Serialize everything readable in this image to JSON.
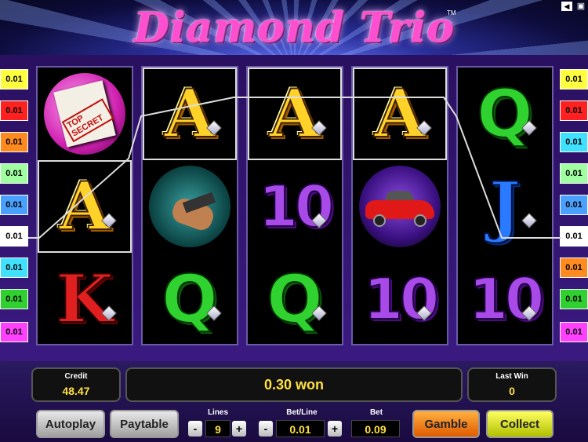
{
  "game": {
    "title": "Diamond Trio",
    "tm": "TM"
  },
  "lines_left": [
    {
      "label": "0.01",
      "color": "#ffff40"
    },
    {
      "label": "0.01",
      "color": "#ff2020"
    },
    {
      "label": "0.01",
      "color": "#ff8a20"
    },
    {
      "label": "0.01",
      "color": "#a0ffa0"
    },
    {
      "label": "0.01",
      "color": "#4aa0ff"
    },
    {
      "label": "0.01",
      "color": "#ffffff"
    },
    {
      "label": "0.01",
      "color": "#40e0ff"
    },
    {
      "label": "0.01",
      "color": "#30d030"
    },
    {
      "label": "0.01",
      "color": "#ff40ff"
    }
  ],
  "lines_right": [
    {
      "label": "0.01",
      "color": "#ffff40"
    },
    {
      "label": "0.01",
      "color": "#ff2020"
    },
    {
      "label": "0.01",
      "color": "#40e0ff"
    },
    {
      "label": "0.01",
      "color": "#a0ffa0"
    },
    {
      "label": "0.01",
      "color": "#4aa0ff"
    },
    {
      "label": "0.01",
      "color": "#ffffff"
    },
    {
      "label": "0.01",
      "color": "#ff8a20"
    },
    {
      "label": "0.01",
      "color": "#30d030"
    },
    {
      "label": "0.01",
      "color": "#ff40ff"
    }
  ],
  "reels": [
    [
      "Top Secret",
      "A",
      "K"
    ],
    [
      "A",
      "Spy",
      "Q"
    ],
    [
      "A",
      "10",
      "Q"
    ],
    [
      "A",
      "Car",
      "10"
    ],
    [
      "Q",
      "J",
      "10"
    ]
  ],
  "secret_stamp": "TOP SECRET",
  "credit": {
    "label": "Credit",
    "value": "48.47"
  },
  "message": "0.30 won",
  "last_win": {
    "label": "Last Win",
    "value": "0"
  },
  "buttons": {
    "autoplay": "Autoplay",
    "paytable": "Paytable",
    "gamble": "Gamble",
    "collect": "Collect",
    "minus": "-",
    "plus": "+"
  },
  "lines": {
    "label": "Lines",
    "value": "9"
  },
  "bet_line": {
    "label": "Bet/Line",
    "value": "0.01"
  },
  "bet": {
    "label": "Bet",
    "value": "0.09"
  },
  "icons": {
    "sound": "speaker-icon",
    "fullscreen": "fullscreen-icon"
  }
}
